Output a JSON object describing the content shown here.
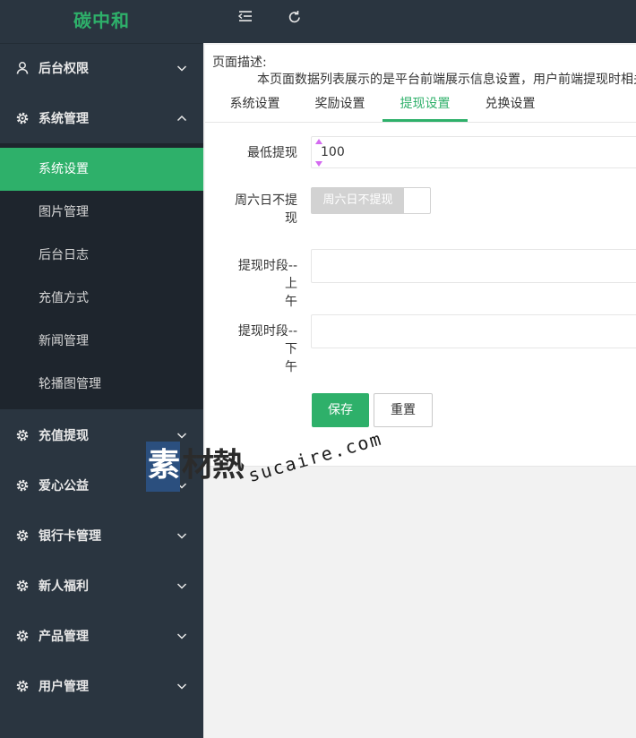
{
  "brand": "碳中和",
  "sidebar": {
    "items": [
      {
        "label": "后台权限",
        "icon": "user-icon"
      },
      {
        "label": "系统管理",
        "icon": "gear-icon",
        "expanded": true
      },
      {
        "label": "充值提现",
        "icon": "gear-icon"
      },
      {
        "label": "爱心公益",
        "icon": "gear-icon"
      },
      {
        "label": "银行卡管理",
        "icon": "gear-icon"
      },
      {
        "label": "新人福利",
        "icon": "gear-icon"
      },
      {
        "label": "产品管理",
        "icon": "gear-icon"
      },
      {
        "label": "用户管理",
        "icon": "gear-icon"
      }
    ],
    "submenu": [
      {
        "label": "系统设置",
        "active": true
      },
      {
        "label": "图片管理"
      },
      {
        "label": "后台日志"
      },
      {
        "label": "充值方式"
      },
      {
        "label": "新闻管理"
      },
      {
        "label": "轮播图管理"
      }
    ]
  },
  "topbar": {
    "menu_toggle_icon": "menu-fold-icon",
    "refresh_icon": "refresh-icon"
  },
  "page": {
    "desc_title": "页面描述:",
    "desc_text": "本页面数据列表展示的是平台前端展示信息设置，用户前端提现时相关",
    "tabs": [
      {
        "label": "系统设置"
      },
      {
        "label": "奖励设置"
      },
      {
        "label": "提现设置",
        "active": true
      },
      {
        "label": "兑换设置"
      }
    ]
  },
  "form": {
    "min_withdraw_label": "最低提现",
    "min_withdraw_value": "100",
    "weekend_label_line1": "周六日不提",
    "weekend_label_line2": "现",
    "weekend_switch_text": "周六日不提现",
    "morning_label_line1": "提现时段--上",
    "morning_label_line2": "午",
    "morning_value": "",
    "afternoon_label_line1": "提现时段--下",
    "afternoon_label_line2": "午",
    "afternoon_value": "",
    "save_label": "保存",
    "reset_label": "重置"
  },
  "watermark": {
    "cn_first": "素",
    "cn_rest": "材熱",
    "en": "sucaire.com"
  },
  "colors": {
    "accent": "#2eb06a",
    "sidebar_bg": "#2a3540",
    "submenu_bg": "#1e252d"
  }
}
